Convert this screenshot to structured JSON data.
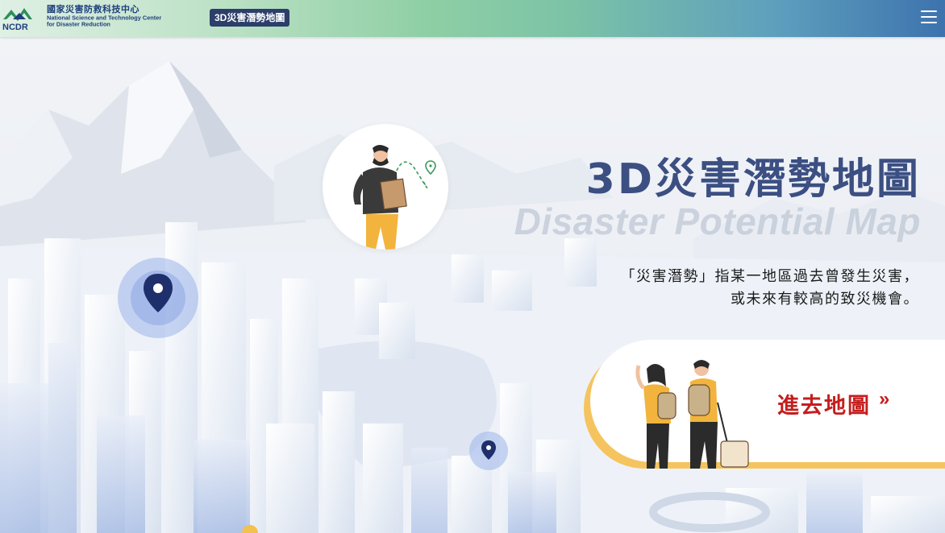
{
  "header": {
    "logo_zh": "國家災害防救科技中心",
    "logo_en_line1": "National Science and Technology Center",
    "logo_en_line2": "for Disaster Reduction",
    "logo_abbr": "NCDR",
    "site_badge": "3D災害潛勢地圖",
    "menu_icon": "hamburger-menu-icon"
  },
  "hero": {
    "title": "3D災害潛勢地圖",
    "subtitle": "Disaster Potential Map",
    "description_line1": "「災害潛勢」指某一地區過去曾發生災害，",
    "description_line2": "或未來有較高的致災機會。"
  },
  "cta": {
    "label": "進去地圖",
    "arrow": "»"
  },
  "colors": {
    "title": "#3b4f82",
    "cta_text": "#c41e1e",
    "cta_accent": "#f5c45e",
    "badge_bg": "#2c3e6a",
    "pin": "#1f2f6b"
  }
}
